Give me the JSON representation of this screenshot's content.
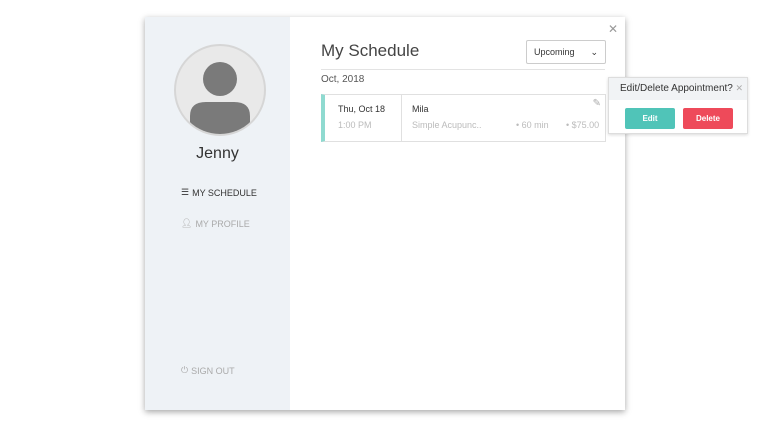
{
  "sidebar": {
    "user_name": "Jenny",
    "nav": [
      {
        "label": "MY SCHEDULE",
        "icon": "list-icon"
      },
      {
        "label": "MY PROFILE",
        "icon": "user-icon"
      }
    ],
    "sign_out": "SIGN OUT"
  },
  "main": {
    "title": "My Schedule",
    "filter": "Upcoming",
    "month": "Oct, 2018",
    "appointments": [
      {
        "date": "Thu, Oct 18",
        "time": "1:00 PM",
        "provider": "Mila",
        "service": "Simple Acupunc..",
        "duration": "• 60 min",
        "price": "• $75.00"
      }
    ]
  },
  "popover": {
    "title": "Edit/Delete Appointment?",
    "edit": "Edit",
    "delete": "Delete"
  },
  "colors": {
    "accent": "#50c4b8",
    "danger": "#ee4a5a",
    "sidebar": "#eef2f6"
  }
}
